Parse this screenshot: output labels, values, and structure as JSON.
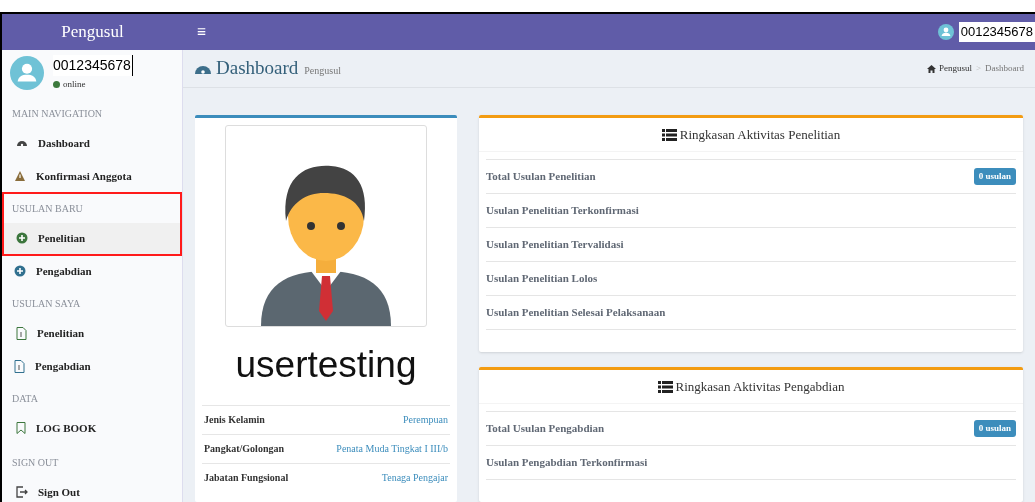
{
  "header": {
    "brand": "Pengusul",
    "menu_glyph": "≡",
    "user_id": "0012345678"
  },
  "sidebar": {
    "user": {
      "id": "0012345678",
      "status": "online"
    },
    "sections": [
      {
        "header": "MAIN NAVIGATION",
        "highlighted": false,
        "items": [
          {
            "label": "Dashboard",
            "kind": "dashboard",
            "selected": false
          },
          {
            "label": "Konfirmasi Anggota",
            "kind": "warning",
            "selected": false
          }
        ]
      },
      {
        "header": "USULAN BARU",
        "highlighted": true,
        "items": [
          {
            "label": "Penelitian",
            "kind": "plus-green",
            "selected": true
          },
          {
            "label": "Pengabdian",
            "kind": "plus-blue",
            "selected": false
          }
        ]
      },
      {
        "header": "USULAN SAYA",
        "highlighted": false,
        "items": [
          {
            "label": "Penelitian",
            "kind": "file-green",
            "selected": false
          },
          {
            "label": "Pengabdian",
            "kind": "file-blue",
            "selected": false
          }
        ]
      },
      {
        "header": "DATA",
        "highlighted": false,
        "items": [
          {
            "label": "LOG BOOK",
            "kind": "bookmark",
            "selected": false
          }
        ]
      },
      {
        "header": "SIGN OUT",
        "highlighted": false,
        "items": [
          {
            "label": "Sign Out",
            "kind": "signout",
            "selected": false
          }
        ]
      }
    ]
  },
  "page": {
    "title": "Dashboard",
    "subtitle": "Pengusul",
    "breadcrumb": {
      "items": [
        "Pengusul",
        "Dashboard"
      ],
      "separator": ">"
    }
  },
  "profile": {
    "name": "usertesting",
    "fields": [
      {
        "label": "Jenis Kelamin",
        "value": "Perempuan"
      },
      {
        "label": "Pangkat/Golongan",
        "value": "Penata Muda Tingkat I III/b"
      },
      {
        "label": "Jabatan Fungsional",
        "value": "Tenaga Pengajar"
      }
    ]
  },
  "summaries": [
    {
      "title": "Ringkasan Aktivitas Penelitian",
      "rows": [
        {
          "label": "Total Usulan Penelitian",
          "badge": "0 usulan"
        },
        {
          "label": "Usulan Penelitian Terkonfirmasi"
        },
        {
          "label": "Usulan Penelitian Tervalidasi"
        },
        {
          "label": "Usulan Penelitian Lolos"
        },
        {
          "label": "Usulan Penelitian Selesai Pelaksanaan"
        }
      ]
    },
    {
      "title": "Ringkasan Aktivitas Pengabdian",
      "rows": [
        {
          "label": "Total Usulan Pengabdian",
          "badge": "0 usulan"
        },
        {
          "label": "Usulan Pengabdian Terkonfirmasi"
        }
      ]
    }
  ]
}
